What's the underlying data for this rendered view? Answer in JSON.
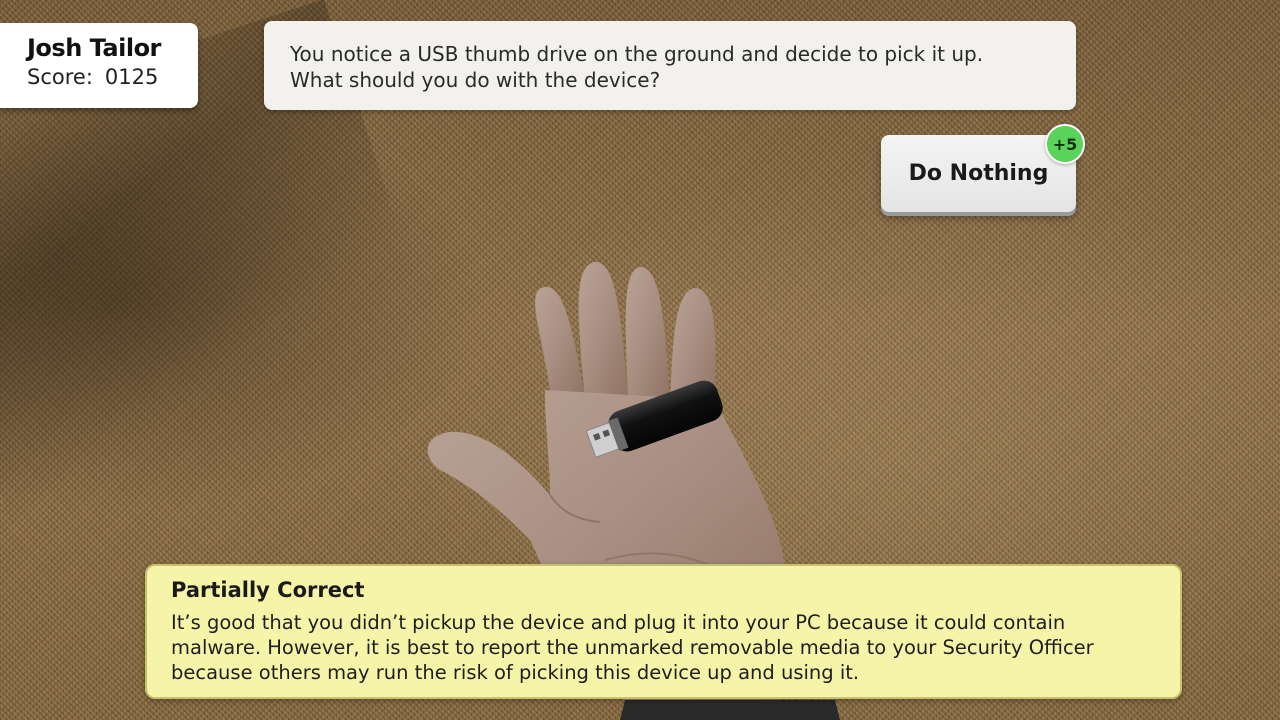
{
  "player": {
    "name": "Josh Tailor",
    "score_label": "Score:",
    "score_value": "0125"
  },
  "question": {
    "line1": "You notice a USB thumb drive on the ground and decide to pick it up.",
    "line2": "What should you do with the device?"
  },
  "answer": {
    "label": "Do Nothing",
    "points": "+5"
  },
  "feedback": {
    "title": "Partially Correct",
    "line1": "It’s good that you didn’t pickup the device and plug it into your PC because it could contain",
    "line2": "malware. However, it is best to report the unmarked removable media to your Security Officer",
    "line3": "because others may run the risk of picking this device up and using it."
  },
  "icons": {
    "scene": "hand-holding-usb-drive"
  },
  "colors": {
    "feedback_background": "#f6f4a8",
    "points_badge": "#5ad35a"
  }
}
